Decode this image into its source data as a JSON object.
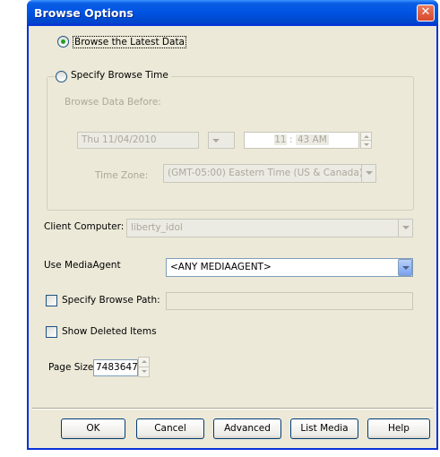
{
  "window": {
    "title": "Browse Options",
    "close_icon": "close-icon"
  },
  "browse_latest": {
    "label": "Browse the Latest Data",
    "checked": true
  },
  "specify_time": {
    "label": "Specify Browse Time",
    "checked": false,
    "before_label": "Browse Data Before:",
    "date_value": "Thu 11/04/2010",
    "time_hour": "11",
    "time_sep": ":",
    "time_rest": "43 AM",
    "timezone_label": "Time Zone:",
    "timezone_value": "(GMT-05:00) Eastern Time (US & Canada)"
  },
  "client": {
    "label": "Client Computer:",
    "value": "liberty_idol"
  },
  "media_agent": {
    "label": "Use MediaAgent",
    "value": "<ANY MEDIAAGENT>"
  },
  "browse_path": {
    "label": "Specify Browse Path:",
    "value": "",
    "checked": false
  },
  "show_deleted": {
    "label": "Show Deleted Items",
    "checked": false
  },
  "page_size": {
    "label": "Page Size:",
    "value": "7483647"
  },
  "buttons": {
    "ok": "OK",
    "cancel": "Cancel",
    "advanced": "Advanced",
    "list_media": "List Media",
    "help": "Help"
  }
}
